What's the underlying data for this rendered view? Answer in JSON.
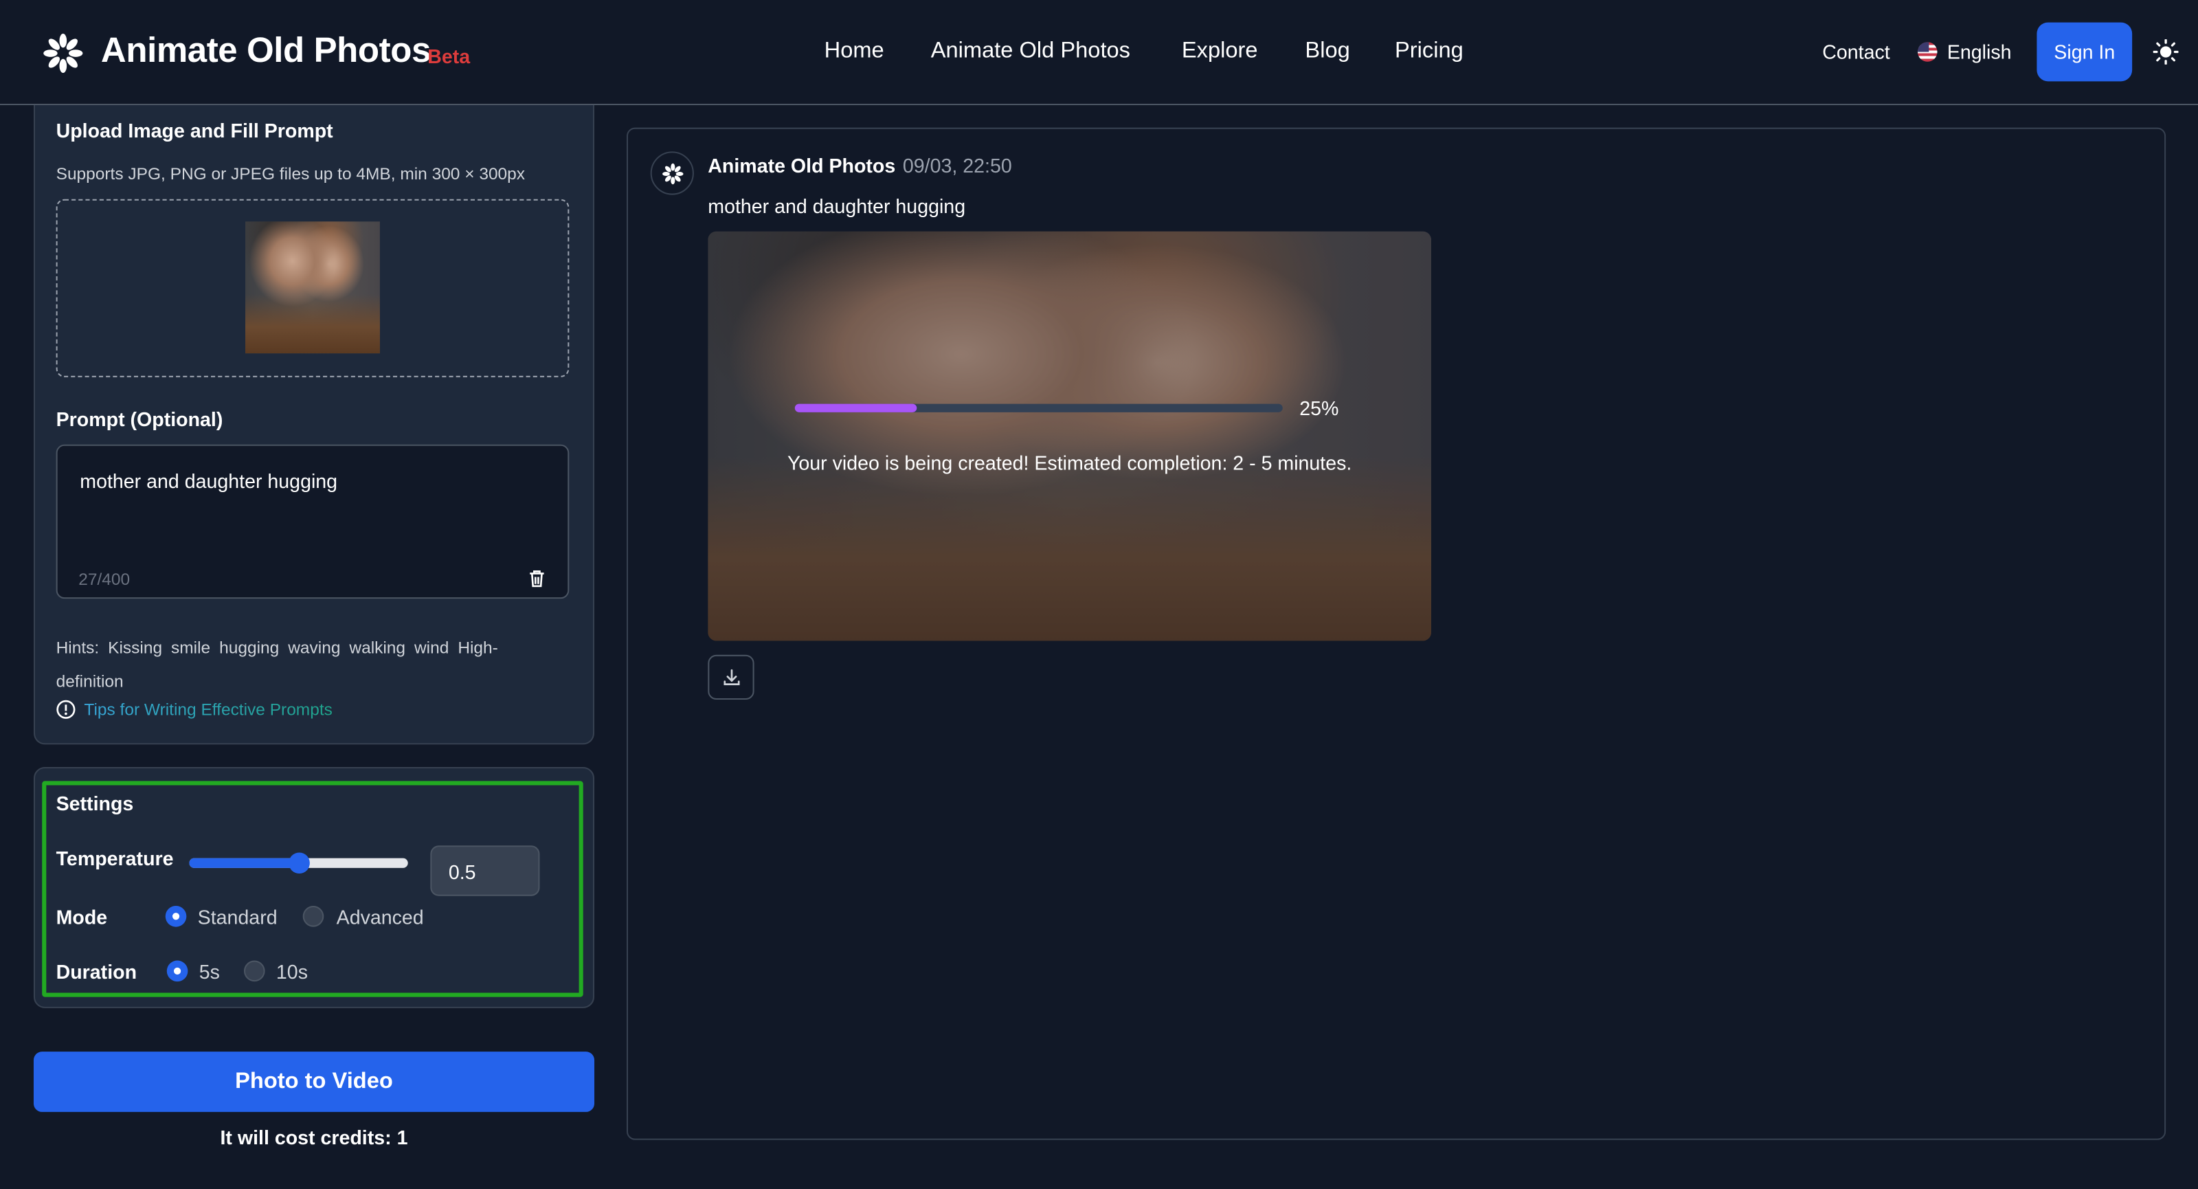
{
  "header": {
    "brand": "Animate Old Photos",
    "badge": "Beta",
    "nav": [
      "Home",
      "Animate Old Photos",
      "Explore",
      "Blog",
      "Pricing"
    ],
    "contact": "Contact",
    "language": "English",
    "sign_in": "Sign In"
  },
  "upload": {
    "title": "Upload Image and Fill Prompt",
    "support": "Supports JPG, PNG or JPEG files up to 4MB, min 300 × 300px",
    "prompt_label": "Prompt (Optional)",
    "prompt_value": "mother and daughter hugging",
    "counter": "27/400",
    "hints_label": "Hints:",
    "hints": [
      "Kissing",
      "smile",
      "hugging",
      "waving",
      "walking",
      "wind",
      "High-definition"
    ],
    "tips": "Tips for Writing Effective Prompts"
  },
  "settings": {
    "title": "Settings",
    "temperature_label": "Temperature",
    "temperature": "0.5",
    "temperature_fraction": 0.5,
    "mode_label": "Mode",
    "modes": [
      "Standard",
      "Advanced"
    ],
    "mode_selected": "Standard",
    "duration_label": "Duration",
    "durations": [
      "5s",
      "10s"
    ],
    "duration_selected": "5s"
  },
  "action": {
    "button": "Photo to Video",
    "cost": "It will cost credits: 1"
  },
  "result": {
    "author": "Animate Old Photos",
    "time": "09/03, 22:50",
    "prompt": "mother and daughter hugging",
    "progress": "25%",
    "progress_value": 25,
    "status": "Your video is being created! Estimated completion: 2 - 5 minutes."
  },
  "colors": {
    "accent": "#2563eb",
    "progress": "#a855f7",
    "highlight": "#22aa22",
    "beta": "#dc3c3c"
  }
}
